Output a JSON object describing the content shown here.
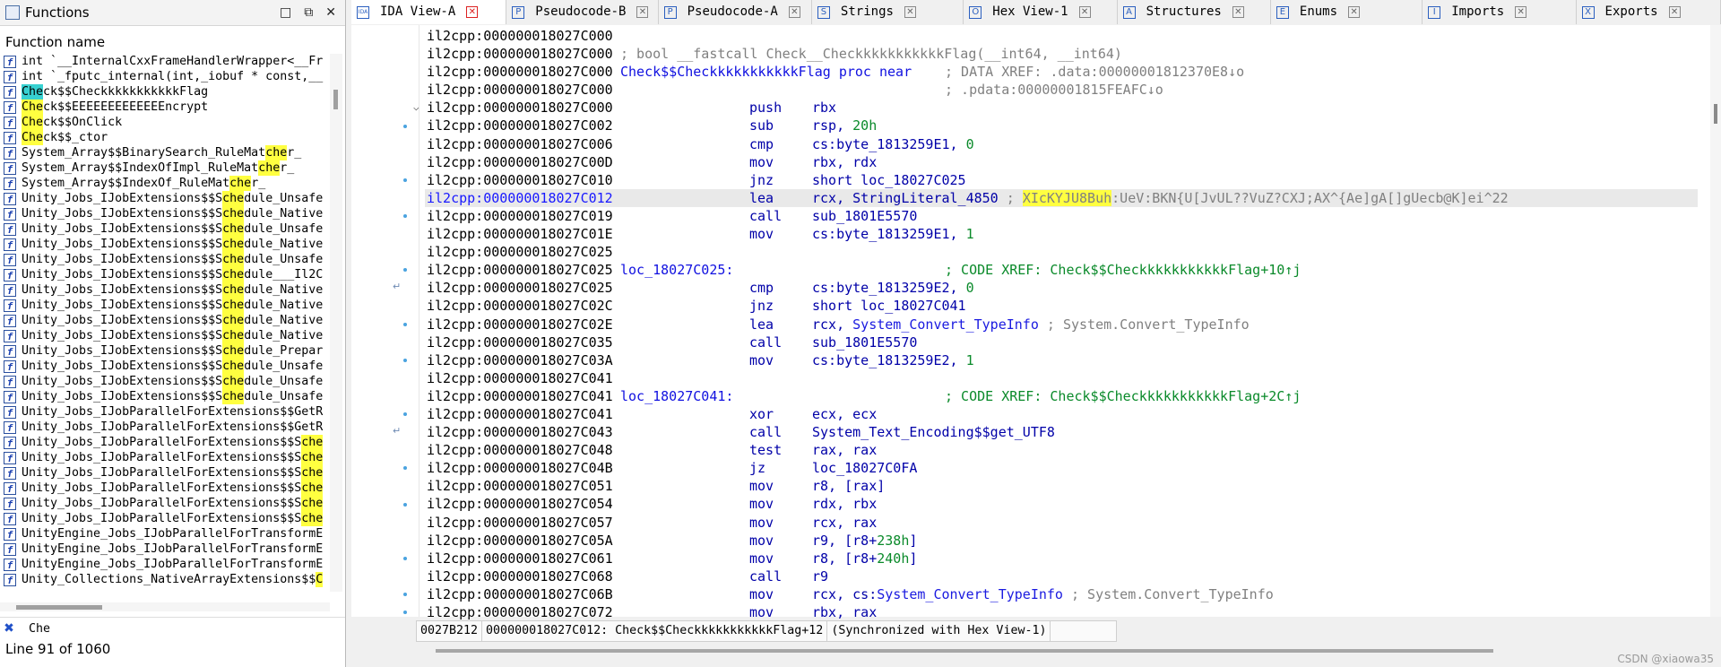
{
  "functions_pane": {
    "title": "Functions",
    "column_header": "Function name",
    "win_buttons": [
      "□",
      "⧉",
      "✕"
    ],
    "items": [
      {
        "pre": "int `__InternalCxxFrameHandlerWrapper<__Fr",
        "hl": "",
        "post": ""
      },
      {
        "pre": "int `_fputc_internal(int,_iobuf * const,__",
        "hl": "",
        "post": ""
      },
      {
        "pre": "",
        "hl": "Che",
        "post": "ck$$CheckkkkkkkkkkkFlag",
        "cyan": true
      },
      {
        "pre": "",
        "hl": "Che",
        "post": "ck$$EEEEEEEEEEEEEncrypt"
      },
      {
        "pre": "",
        "hl": "Che",
        "post": "ck$$OnClick"
      },
      {
        "pre": "",
        "hl": "Che",
        "post": "ck$$_ctor"
      },
      {
        "pre": "System_Array$$BinarySearch_RuleMat",
        "hl": "che",
        "post": "r_"
      },
      {
        "pre": "System_Array$$IndexOfImpl_RuleMat",
        "hl": "che",
        "post": "r_"
      },
      {
        "pre": "System_Array$$IndexOf_RuleMat",
        "hl": "che",
        "post": "r_"
      },
      {
        "pre": "Unity_Jobs_IJobExtensions$$S",
        "hl": "che",
        "post": "dule_Unsafe"
      },
      {
        "pre": "Unity_Jobs_IJobExtensions$$S",
        "hl": "che",
        "post": "dule_Native"
      },
      {
        "pre": "Unity_Jobs_IJobExtensions$$S",
        "hl": "che",
        "post": "dule_Unsafe"
      },
      {
        "pre": "Unity_Jobs_IJobExtensions$$S",
        "hl": "che",
        "post": "dule_Native"
      },
      {
        "pre": "Unity_Jobs_IJobExtensions$$S",
        "hl": "che",
        "post": "dule_Unsafe"
      },
      {
        "pre": "Unity_Jobs_IJobExtensions$$S",
        "hl": "che",
        "post": "dule___Il2C"
      },
      {
        "pre": "Unity_Jobs_IJobExtensions$$S",
        "hl": "che",
        "post": "dule_Native"
      },
      {
        "pre": "Unity_Jobs_IJobExtensions$$S",
        "hl": "che",
        "post": "dule_Native"
      },
      {
        "pre": "Unity_Jobs_IJobExtensions$$S",
        "hl": "che",
        "post": "dule_Native"
      },
      {
        "pre": "Unity_Jobs_IJobExtensions$$S",
        "hl": "che",
        "post": "dule_Native"
      },
      {
        "pre": "Unity_Jobs_IJobExtensions$$S",
        "hl": "che",
        "post": "dule_Prepar"
      },
      {
        "pre": "Unity_Jobs_IJobExtensions$$S",
        "hl": "che",
        "post": "dule_Unsafe"
      },
      {
        "pre": "Unity_Jobs_IJobExtensions$$S",
        "hl": "che",
        "post": "dule_Unsafe"
      },
      {
        "pre": "Unity_Jobs_IJobExtensions$$S",
        "hl": "che",
        "post": "dule_Unsafe"
      },
      {
        "pre": "Unity_Jobs_IJobParallelForExtensions$$GetR",
        "hl": "",
        "post": ""
      },
      {
        "pre": "Unity_Jobs_IJobParallelForExtensions$$GetR",
        "hl": "",
        "post": ""
      },
      {
        "pre": "Unity_Jobs_IJobParallelForExtensions$$S",
        "hl": "che",
        "post": ""
      },
      {
        "pre": "Unity_Jobs_IJobParallelForExtensions$$S",
        "hl": "che",
        "post": ""
      },
      {
        "pre": "Unity_Jobs_IJobParallelForExtensions$$S",
        "hl": "che",
        "post": ""
      },
      {
        "pre": "Unity_Jobs_IJobParallelForExtensions$$S",
        "hl": "che",
        "post": ""
      },
      {
        "pre": "Unity_Jobs_IJobParallelForExtensions$$S",
        "hl": "che",
        "post": ""
      },
      {
        "pre": "Unity_Jobs_IJobParallelForExtensions$$S",
        "hl": "che",
        "post": ""
      },
      {
        "pre": "UnityEngine_Jobs_IJobParallelForTransformE",
        "hl": "",
        "post": ""
      },
      {
        "pre": "UnityEngine_Jobs_IJobParallelForTransformE",
        "hl": "",
        "post": ""
      },
      {
        "pre": "UnityEngine_Jobs_IJobParallelForTransformE",
        "hl": "",
        "post": ""
      },
      {
        "pre": "Unity_Collections_NativeArrayExtensions$$",
        "hl": "C",
        "post": ""
      }
    ],
    "filter_value": "Che",
    "status": "Line 91 of 1060"
  },
  "tabs": [
    {
      "label": "IDA View-A",
      "icon": "IDA",
      "active": true,
      "close": "✕"
    },
    {
      "label": "Pseudocode-B",
      "icon": "P",
      "active": false,
      "close": "✕"
    },
    {
      "label": "Pseudocode-A",
      "icon": "P",
      "active": false,
      "close": "✕"
    },
    {
      "label": "Strings",
      "icon": "S",
      "active": false,
      "close": "✕"
    },
    {
      "label": "Hex View-1",
      "icon": "O",
      "active": false,
      "close": "✕"
    },
    {
      "label": "Structures",
      "icon": "A",
      "active": false,
      "close": "✕"
    },
    {
      "label": "Enums",
      "icon": "E",
      "active": false,
      "close": "✕"
    },
    {
      "label": "Imports",
      "icon": "I",
      "active": false,
      "close": "✕"
    },
    {
      "label": "Exports",
      "icon": "X",
      "active": false,
      "close": "✕"
    }
  ],
  "disasm": [
    {
      "addr": "il2cpp:000000018027C000"
    },
    {
      "addr": "il2cpp:000000018027C000",
      "head_comment": "; bool __fastcall Check__CheckkkkkkkkkkkFlag(__int64, __int64)"
    },
    {
      "addr": "il2cpp:000000018027C000",
      "label": "Check$$CheckkkkkkkkkkkFlag proc near",
      "xref": "; DATA XREF: .data:00000001812370E8↓o"
    },
    {
      "addr": "il2cpp:000000018027C000",
      "xref": "; .pdata:00000001815FEAFC↓o"
    },
    {
      "addr": "il2cpp:000000018027C000",
      "mnem": "push",
      "ops": [
        {
          "t": "rbx"
        }
      ],
      "fold": true
    },
    {
      "addr": "il2cpp:000000018027C002",
      "mnem": "sub",
      "ops": [
        {
          "t": "rsp, "
        },
        {
          "t": "20h",
          "c": "num"
        }
      ]
    },
    {
      "addr": "il2cpp:000000018027C006",
      "mnem": "cmp",
      "ops": [
        {
          "t": "cs:byte_1813259E1, "
        },
        {
          "t": "0",
          "c": "num"
        }
      ]
    },
    {
      "addr": "il2cpp:000000018027C00D",
      "mnem": "mov",
      "ops": [
        {
          "t": "rbx, rdx"
        }
      ]
    },
    {
      "addr": "il2cpp:000000018027C010",
      "mnem": "jnz",
      "ops": [
        {
          "t": "short loc_18027C025"
        }
      ]
    },
    {
      "addr": "il2cpp:000000018027C012",
      "mnem": "lea",
      "ops": [
        {
          "t": "rcx, StringLiteral_4850 "
        },
        {
          "t": "; ",
          "c": "cmt"
        },
        {
          "t": "XIcKYJU8Buh",
          "c": "strhl"
        },
        {
          "t": ":UeV:BKN{U[JvUL??VuZ?CXJ;AX^{Ae]gA[]gUecb@K]ei^22",
          "c": "cmt"
        }
      ],
      "highlight": true
    },
    {
      "addr": "il2cpp:000000018027C019",
      "mnem": "call",
      "ops": [
        {
          "t": "sub_1801E5570"
        }
      ]
    },
    {
      "addr": "il2cpp:000000018027C01E",
      "mnem": "mov",
      "ops": [
        {
          "t": "cs:byte_1813259E1, "
        },
        {
          "t": "1",
          "c": "num"
        }
      ]
    },
    {
      "addr": "il2cpp:000000018027C025"
    },
    {
      "addr": "il2cpp:000000018027C025",
      "label": "loc_18027C025:",
      "xref2": "; CODE XREF: Check$$CheckkkkkkkkkkkFlag+10↑j"
    },
    {
      "addr": "il2cpp:000000018027C025",
      "mnem": "cmp",
      "ops": [
        {
          "t": "cs:byte_1813259E2, "
        },
        {
          "t": "0",
          "c": "num"
        }
      ]
    },
    {
      "addr": "il2cpp:000000018027C02C",
      "mnem": "jnz",
      "ops": [
        {
          "t": "short loc_18027C041"
        }
      ]
    },
    {
      "addr": "il2cpp:000000018027C02E",
      "mnem": "lea",
      "ops": [
        {
          "t": "rcx, "
        },
        {
          "t": "System_Convert_TypeInfo",
          "c": "sym"
        },
        {
          "t": " ; System.Convert_TypeInfo",
          "c": "cmt"
        }
      ]
    },
    {
      "addr": "il2cpp:000000018027C035",
      "mnem": "call",
      "ops": [
        {
          "t": "sub_1801E5570"
        }
      ]
    },
    {
      "addr": "il2cpp:000000018027C03A",
      "mnem": "mov",
      "ops": [
        {
          "t": "cs:byte_1813259E2, "
        },
        {
          "t": "1",
          "c": "num"
        }
      ]
    },
    {
      "addr": "il2cpp:000000018027C041"
    },
    {
      "addr": "il2cpp:000000018027C041",
      "label": "loc_18027C041:",
      "xref2": "; CODE XREF: Check$$CheckkkkkkkkkkkFlag+2C↑j"
    },
    {
      "addr": "il2cpp:000000018027C041",
      "mnem": "xor",
      "ops": [
        {
          "t": "ecx, ecx"
        }
      ]
    },
    {
      "addr": "il2cpp:000000018027C043",
      "mnem": "call",
      "ops": [
        {
          "t": "System_Text_Encoding$$get_UTF8"
        }
      ]
    },
    {
      "addr": "il2cpp:000000018027C048",
      "mnem": "test",
      "ops": [
        {
          "t": "rax, rax"
        }
      ]
    },
    {
      "addr": "il2cpp:000000018027C04B",
      "mnem": "jz",
      "ops": [
        {
          "t": "loc_18027C0FA"
        }
      ]
    },
    {
      "addr": "il2cpp:000000018027C051",
      "mnem": "mov",
      "ops": [
        {
          "t": "r8, [rax]"
        }
      ]
    },
    {
      "addr": "il2cpp:000000018027C054",
      "mnem": "mov",
      "ops": [
        {
          "t": "rdx, rbx"
        }
      ]
    },
    {
      "addr": "il2cpp:000000018027C057",
      "mnem": "mov",
      "ops": [
        {
          "t": "rcx, rax"
        }
      ]
    },
    {
      "addr": "il2cpp:000000018027C05A",
      "mnem": "mov",
      "ops": [
        {
          "t": "r9, [r8+"
        },
        {
          "t": "238h",
          "c": "num"
        },
        {
          "t": "]"
        }
      ]
    },
    {
      "addr": "il2cpp:000000018027C061",
      "mnem": "mov",
      "ops": [
        {
          "t": "r8, [r8+"
        },
        {
          "t": "240h",
          "c": "num"
        },
        {
          "t": "]"
        }
      ]
    },
    {
      "addr": "il2cpp:000000018027C068",
      "mnem": "call",
      "ops": [
        {
          "t": "r9"
        }
      ]
    },
    {
      "addr": "il2cpp:000000018027C06B",
      "mnem": "mov",
      "ops": [
        {
          "t": "rcx, cs:"
        },
        {
          "t": "System_Convert_TypeInfo",
          "c": "sym"
        },
        {
          "t": " ; System.Convert_TypeInfo",
          "c": "cmt"
        }
      ]
    },
    {
      "addr": "il2cpp:000000018027C072",
      "mnem": "mov",
      "ops": [
        {
          "t": "rbx, rax"
        }
      ]
    }
  ],
  "status_bar": {
    "offset": "0027B212",
    "location": "000000018027C012: Check$$CheckkkkkkkkkkkFlag+12",
    "sync": "(Synchronized with Hex View-1)"
  },
  "watermark": "CSDN @xiaowa35"
}
